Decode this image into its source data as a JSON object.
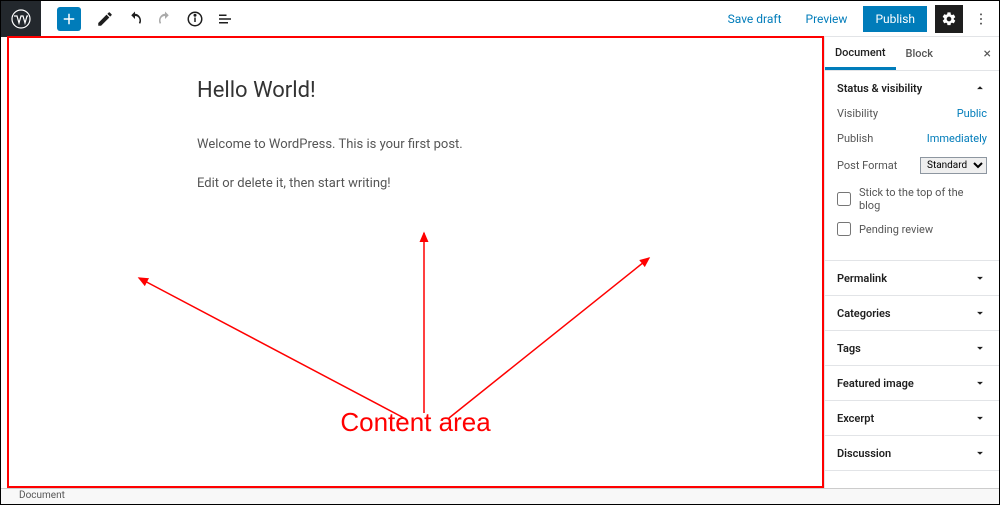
{
  "toolbar": {
    "save_draft": "Save draft",
    "preview": "Preview",
    "publish": "Publish"
  },
  "post": {
    "title": "Hello World!",
    "paragraphs": [
      "Welcome to WordPress. This is your first post.",
      "Edit or delete it, then start writing!"
    ]
  },
  "annotation": {
    "label": "Content area"
  },
  "sidebar": {
    "tabs": {
      "document": "Document",
      "block": "Block"
    },
    "status": {
      "title": "Status & visibility",
      "visibility_label": "Visibility",
      "visibility_value": "Public",
      "publish_label": "Publish",
      "publish_value": "Immediately",
      "format_label": "Post Format",
      "format_value": "Standard",
      "stick_label": "Stick to the top of the blog",
      "pending_label": "Pending review"
    },
    "panels": {
      "permalink": "Permalink",
      "categories": "Categories",
      "tags": "Tags",
      "featured": "Featured image",
      "excerpt": "Excerpt",
      "discussion": "Discussion"
    }
  },
  "statusbar": {
    "breadcrumb": "Document"
  }
}
